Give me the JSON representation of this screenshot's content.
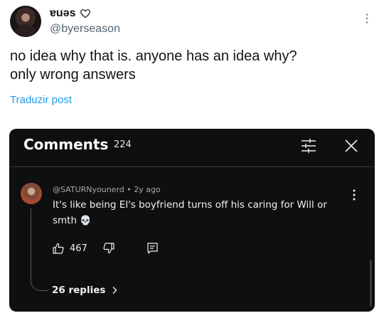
{
  "tweet": {
    "display_name": "ɐuəs",
    "handle": "@byerseason",
    "text": "no idea why that is. anyone has an idea why?\nonly wrong answers",
    "translate_label": "Traduzir post"
  },
  "comments_panel": {
    "title": "Comments",
    "count": "224",
    "comment": {
      "author": "@SATURNyounerd",
      "separator": "•",
      "time": "2y ago",
      "text": "It's like being El's boyfriend turns off his caring for Will or smth",
      "emoji": "💀",
      "likes": "467",
      "replies_label": "26 replies"
    }
  },
  "icons": {
    "heart": "heart-outline-icon",
    "more": "more-vertical-icon",
    "filter": "filter-sliders-icon",
    "close": "close-icon",
    "like": "thumbs-up-icon",
    "dislike": "thumbs-down-icon",
    "reply": "reply-icon",
    "chevron": "chevron-right-icon"
  },
  "colors": {
    "link": "#1d9bf0",
    "panel_bg": "#0f0f0f",
    "muted": "#aaaaaa"
  }
}
